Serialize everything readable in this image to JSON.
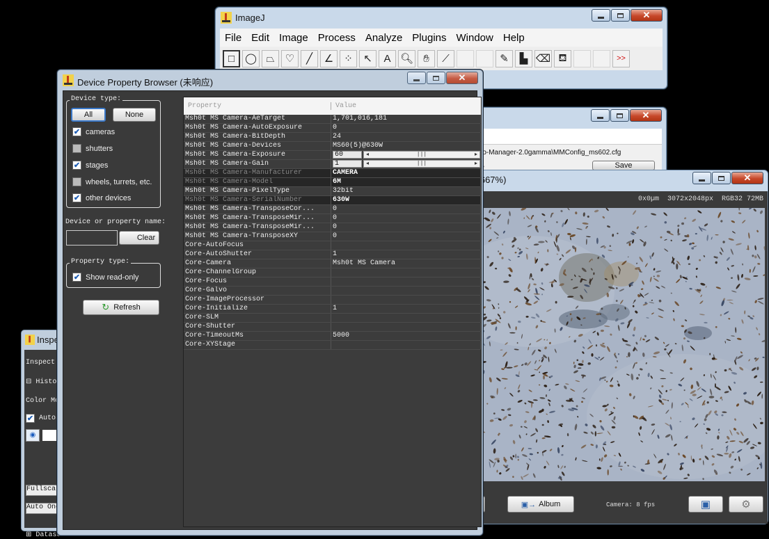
{
  "imagej": {
    "title": "ImageJ",
    "menus": [
      "File",
      "Edit",
      "Image",
      "Process",
      "Analyze",
      "Plugins",
      "Window",
      "Help"
    ],
    "overflow_label": ">>"
  },
  "mm_window": {
    "config_path": "cro-Manager-2.0gamma\\MMConfig_ms602.cfg",
    "save_label": "Save",
    "partial_text": "re"
  },
  "image_window": {
    "title_fragment": ".6667%)",
    "info": "0x0µm  3072x2048px  RGB32 72MB",
    "album_label": "Album",
    "camera_status": "Camera: 8 fps",
    "partial_btn": "e"
  },
  "dpb": {
    "title": "Device Property Browser (未响应)",
    "device_type_label": "Device type:",
    "all_label": "All",
    "none_label": "None",
    "filters": [
      {
        "label": "cameras",
        "checked": true
      },
      {
        "label": "shutters",
        "checked": false
      },
      {
        "label": "stages",
        "checked": true
      },
      {
        "label": "wheels, turrets, etc.",
        "checked": false
      },
      {
        "label": "other devices",
        "checked": true
      }
    ],
    "search_label": "Device or property name:",
    "clear_label": "Clear",
    "property_type_label": "Property type:",
    "show_readonly_label": "Show read-only",
    "refresh_label": "Refresh",
    "columns": [
      "Property",
      "Value"
    ],
    "rows": [
      {
        "p": "Msh0t MS Camera-AeTarget",
        "v": "1,701,016,181",
        "ro": false
      },
      {
        "p": "Msh0t MS Camera-AutoExposure",
        "v": "0",
        "ro": false
      },
      {
        "p": "Msh0t MS Camera-BitDepth",
        "v": "24",
        "ro": false
      },
      {
        "p": "Msh0t MS Camera-Devices",
        "v": "MS60(5)@630W",
        "ro": false
      },
      {
        "p": "Msh0t MS Camera-Exposure",
        "v": "60",
        "ro": false,
        "slider": true
      },
      {
        "p": "Msh0t MS Camera-Gain",
        "v": "1",
        "ro": false,
        "slider": true
      },
      {
        "p": "Msh0t MS Camera-Manufacturer",
        "v": "CAMERA",
        "ro": true
      },
      {
        "p": "Msh0t MS Camera-Model",
        "v": "6M",
        "ro": true
      },
      {
        "p": "Msh0t MS Camera-PixelType",
        "v": "32bit",
        "ro": false
      },
      {
        "p": "Msh0t MS Camera-SerialNumber",
        "v": "630W",
        "ro": true
      },
      {
        "p": "Msh0t MS Camera-TransposeCor...",
        "v": "0",
        "ro": false
      },
      {
        "p": "Msh0t MS Camera-TransposeMir...",
        "v": "0",
        "ro": false
      },
      {
        "p": "Msh0t MS Camera-TransposeMir...",
        "v": "0",
        "ro": false
      },
      {
        "p": "Msh0t MS Camera-TransposeXY",
        "v": "0",
        "ro": false
      },
      {
        "p": "Core-AutoFocus",
        "v": "",
        "ro": false
      },
      {
        "p": "Core-AutoShutter",
        "v": "1",
        "ro": false
      },
      {
        "p": "Core-Camera",
        "v": "Msh0t MS Camera",
        "ro": false
      },
      {
        "p": "Core-ChannelGroup",
        "v": "",
        "ro": false
      },
      {
        "p": "Core-Focus",
        "v": "",
        "ro": false
      },
      {
        "p": "Core-Galvo",
        "v": "",
        "ro": false
      },
      {
        "p": "Core-ImageProcessor",
        "v": "",
        "ro": false
      },
      {
        "p": "Core-Initialize",
        "v": "1",
        "ro": false
      },
      {
        "p": "Core-SLM",
        "v": "",
        "ro": false
      },
      {
        "p": "Core-Shutter",
        "v": "",
        "ro": false
      },
      {
        "p": "Core-TimeoutMs",
        "v": "5000",
        "ro": false
      },
      {
        "p": "Core-XYStage",
        "v": "",
        "ro": false
      }
    ]
  },
  "inspector": {
    "title": "Inspe",
    "rows": [
      "Inspect:",
      "⊟ Histog",
      "Color Mo",
      "Autos",
      "",
      "Fullscal",
      "Auto Onc",
      "⊞ Datase"
    ]
  },
  "colors": {
    "accent_close": "#c7482a",
    "panel_bg": "#3a3a3a",
    "titlebar": "#c9d9ea"
  }
}
